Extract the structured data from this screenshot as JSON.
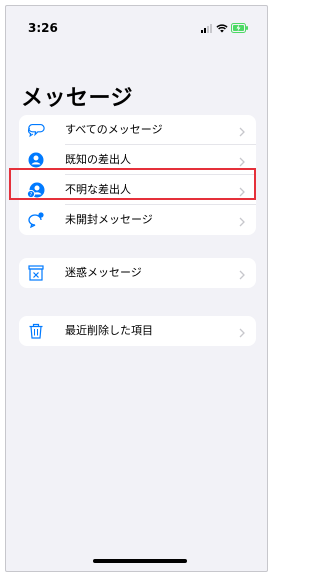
{
  "status_bar": {
    "time": "3:26"
  },
  "page": {
    "title": "メッセージ"
  },
  "groups": [
    {
      "items": [
        {
          "label": "すべてのメッセージ",
          "icon": "speech-bubbles-icon"
        },
        {
          "label": "既知の差出人",
          "icon": "person-circle-icon"
        },
        {
          "label": "不明な差出人",
          "icon": "unknown-person-icon",
          "highlighted": true
        },
        {
          "label": "未開封メッセージ",
          "icon": "unread-bubble-icon"
        }
      ]
    },
    {
      "items": [
        {
          "label": "迷惑メッセージ",
          "icon": "junk-box-icon"
        }
      ]
    },
    {
      "items": [
        {
          "label": "最近削除した項目",
          "icon": "trash-icon"
        }
      ]
    }
  ],
  "colors": {
    "accent": "#007aff",
    "highlight_border": "#e5303a",
    "background": "#f2f2f7",
    "battery": "#4cd964"
  }
}
